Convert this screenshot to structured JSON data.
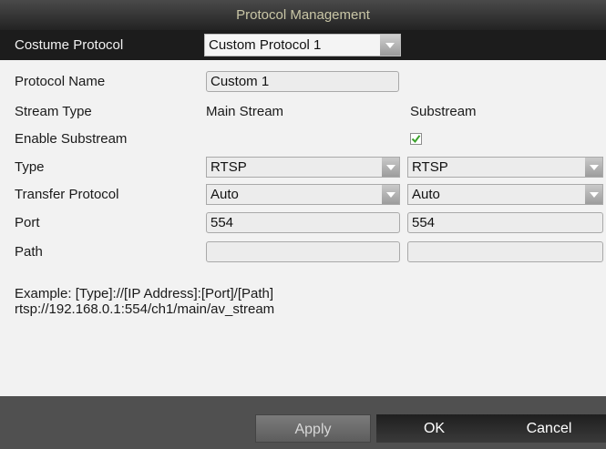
{
  "window": {
    "title": "Protocol Management"
  },
  "protocol": {
    "label": "Costume Protocol",
    "selected": "Custom Protocol 1"
  },
  "form": {
    "name_label": "Protocol Name",
    "name_value": "Custom 1",
    "stream_type_label": "Stream Type",
    "main_stream": "Main Stream",
    "substream": "Substream",
    "enable_substream_label": "Enable Substream",
    "enable_substream_checked": true,
    "type_label": "Type",
    "type_main": "RTSP",
    "type_sub": "RTSP",
    "transfer_label": "Transfer Protocol",
    "transfer_main": "Auto",
    "transfer_sub": "Auto",
    "port_label": "Port",
    "port_main": "554",
    "port_sub": "554",
    "path_label": "Path",
    "path_main": "",
    "path_sub": ""
  },
  "example": {
    "line1": "Example: [Type]://[IP Address]:[Port]/[Path]",
    "line2": "rtsp://192.168.0.1:554/ch1/main/av_stream"
  },
  "buttons": {
    "apply": "Apply",
    "ok": "OK",
    "cancel": "Cancel"
  },
  "icons": {
    "dropdown": "chevron-down-icon",
    "check": "checkmark-icon"
  }
}
